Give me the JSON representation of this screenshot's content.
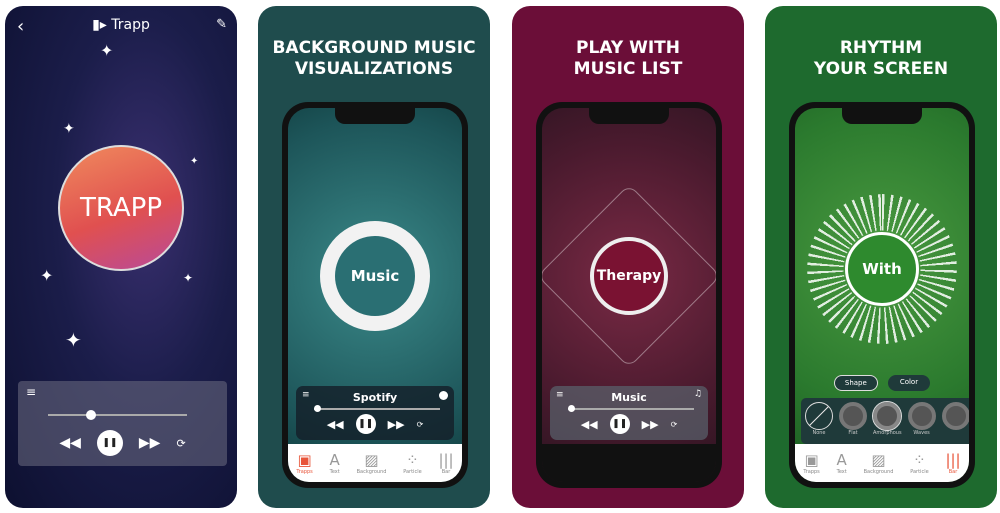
{
  "panel1": {
    "title": "Trapp",
    "orb_text": "TRAPP",
    "icons": [
      "back-icon",
      "waveform-logo-icon",
      "edit-icon"
    ]
  },
  "panel2": {
    "heading": "BACKGROUND MUSIC\nVISUALIZATIONS",
    "orb_text": "Music",
    "player_title": "Spotify"
  },
  "panel3": {
    "heading": "PLAY WITH\nMUSIC LIST",
    "orb_text": "Therapy",
    "player_title": "Music"
  },
  "panel4": {
    "heading": "RHYTHM\nYOUR SCREEN",
    "orb_text": "With",
    "toggle": [
      "Shape",
      "Color"
    ],
    "shapes": [
      "None",
      "Flat",
      "Amorphous",
      "Waves"
    ]
  },
  "tabs": [
    "Trapps",
    "Text",
    "Background",
    "Particle",
    "Bar"
  ],
  "colors": {
    "accent": "#e8553a",
    "teal": "#1f4c4d",
    "maroon": "#6b0e38",
    "green": "#1e6a2e"
  }
}
